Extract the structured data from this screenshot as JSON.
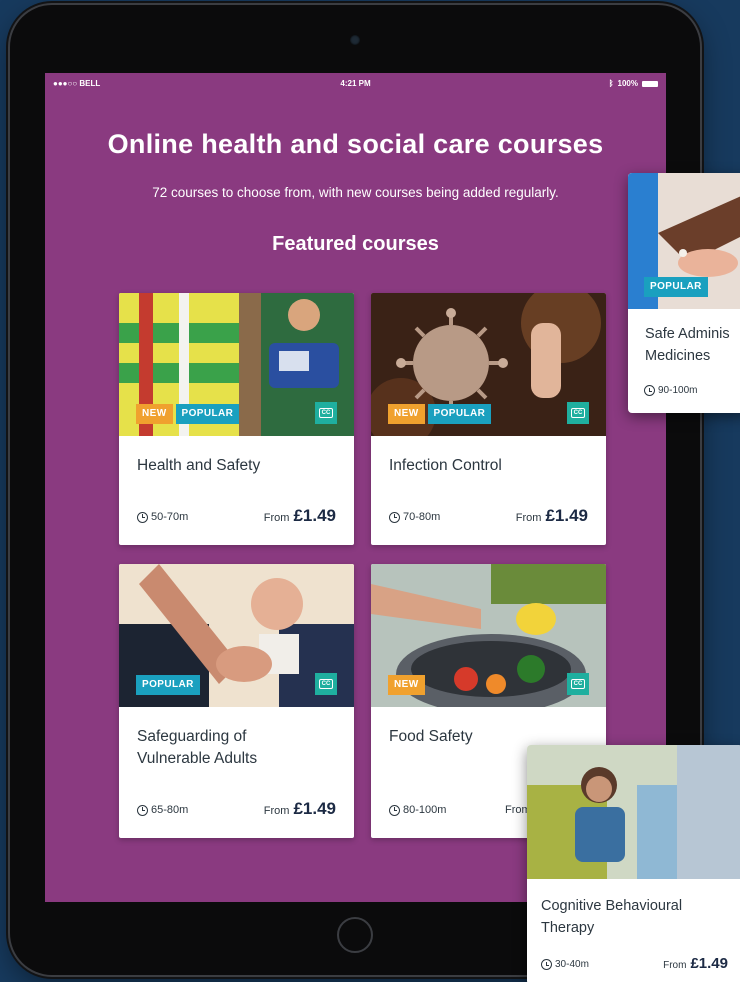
{
  "status_bar": {
    "carrier": "●●●○○ BELL",
    "time": "4:21 PM",
    "battery": "100%"
  },
  "page": {
    "title": "Online health and social care courses",
    "subtitle": "72 courses to choose from, with new courses being added regularly.",
    "featured_heading": "Featured courses"
  },
  "labels": {
    "new": "NEW",
    "popular": "POPULAR",
    "cc": "CC",
    "from": "From"
  },
  "courses": [
    {
      "title": "Health and Safety",
      "duration": "50-70m",
      "price": "£1.49",
      "badges": [
        "NEW",
        "POPULAR"
      ]
    },
    {
      "title": "Infection Control",
      "duration": "70-80m",
      "price": "£1.49",
      "badges": [
        "NEW",
        "POPULAR"
      ]
    },
    {
      "title": "Safeguarding of Vulnerable Adults",
      "duration": "65-80m",
      "price": "£1.49",
      "badges": [
        "POPULAR"
      ]
    },
    {
      "title": "Food Safety",
      "duration": "80-100m",
      "price": "",
      "badges": [
        "NEW"
      ]
    }
  ],
  "floating_courses": [
    {
      "title": "Safe Adminis Medicines",
      "duration": "90-100m",
      "badges": [
        "POPULAR"
      ]
    },
    {
      "title": "Cognitive Behavioural Therapy",
      "duration": "30-40m",
      "price": "£1.49"
    }
  ],
  "colors": {
    "background": "#173a5e",
    "screen": "#8a3a80",
    "badge_new": "#f0a12e",
    "badge_popular": "#1aa0bf",
    "cc_badge": "#1faf9f",
    "price": "#1c2a44"
  }
}
